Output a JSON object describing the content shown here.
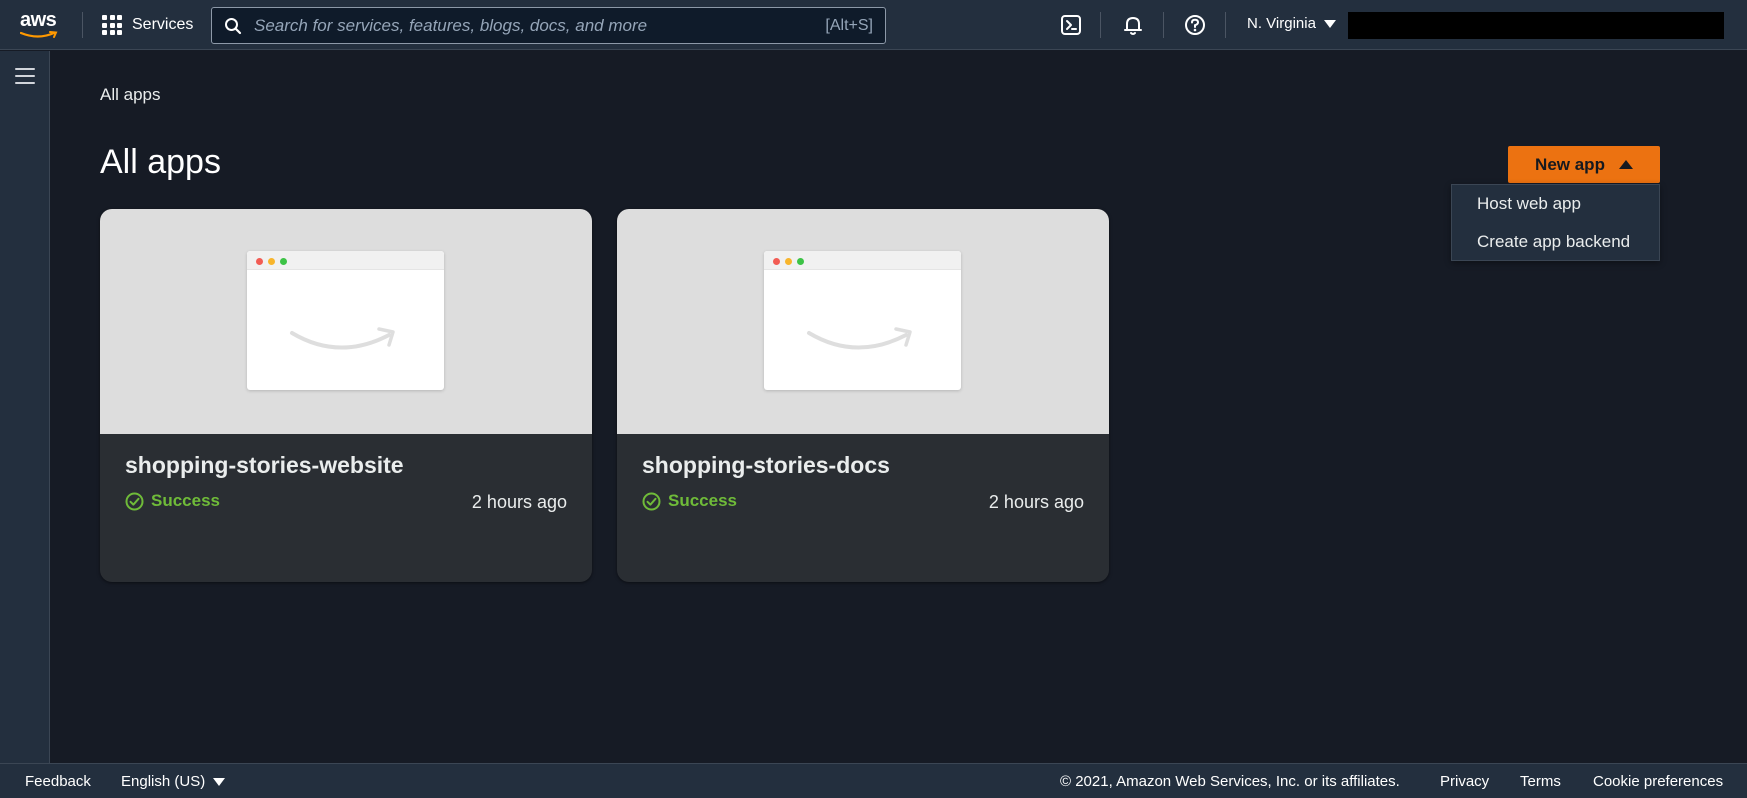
{
  "topnav": {
    "logo_text": "aws",
    "services_label": "Services",
    "search_placeholder": "Search for services, features, blogs, docs, and more",
    "search_shortcut": "[Alt+S]",
    "region": "N. Virginia"
  },
  "breadcrumb": "All apps",
  "page_title": "All apps",
  "new_app": {
    "label": "New app",
    "menu": [
      "Host web app",
      "Create app backend"
    ]
  },
  "apps": [
    {
      "name": "shopping-stories-website",
      "status": "Success",
      "time": "2 hours ago"
    },
    {
      "name": "shopping-stories-docs",
      "status": "Success",
      "time": "2 hours ago"
    }
  ],
  "footer": {
    "feedback": "Feedback",
    "language": "English (US)",
    "copyright": "© 2021, Amazon Web Services, Inc. or its affiliates.",
    "privacy": "Privacy",
    "terms": "Terms",
    "cookies": "Cookie preferences"
  },
  "colors": {
    "accent": "#ec7211",
    "success": "#6fbb39",
    "nav_bg": "#232f3e",
    "page_bg": "#161b25"
  }
}
